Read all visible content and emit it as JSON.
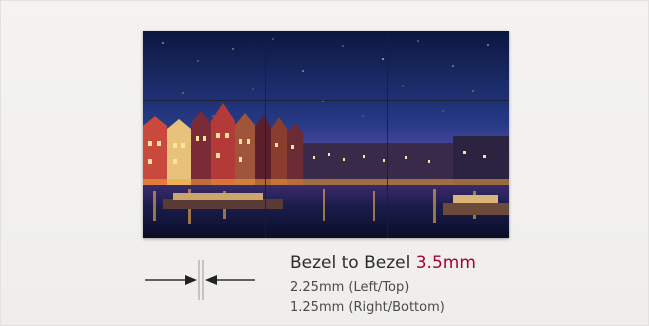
{
  "product": {
    "headline_prefix": "Bezel to Bezel ",
    "headline_value": "3.5mm",
    "detail_left_top": "2.25mm (Left/Top)",
    "detail_right_bottom": "1.25mm (Right/Bottom)"
  },
  "video_wall": {
    "rows": 2,
    "cols": 3,
    "image_subject": "night-city-canal-photo"
  },
  "colors": {
    "accent": "#a50034",
    "text": "#2b2b2b",
    "background": "#f1f0ee"
  },
  "icons": {
    "bezel_gap": "bezel-gap-arrows-icon"
  }
}
